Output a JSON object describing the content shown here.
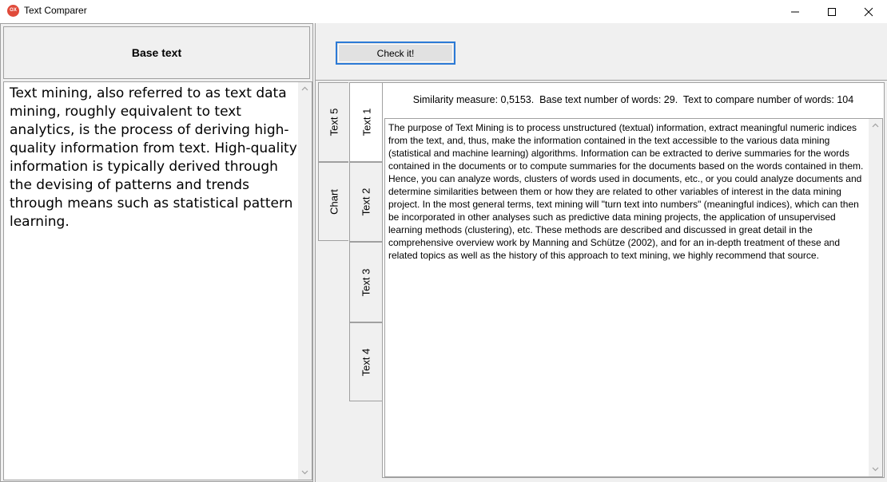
{
  "window": {
    "title": "Text Comparer",
    "app_icon": "OX",
    "controls": [
      "minimize-icon",
      "maximize-icon",
      "close-icon"
    ]
  },
  "left": {
    "header": "Base text",
    "base_text": "Text mining, also referred to as text data mining, roughly equivalent to text analytics, is the process of deriving high-quality information from text. High-quality information is typically derived through the devising of patterns and trends through means such as statistical pattern learning."
  },
  "toolbar": {
    "check_label": "Check it!"
  },
  "tabs": {
    "outer": [
      "Text 5",
      "Chart"
    ],
    "inner": [
      "Text 1",
      "Text 2",
      "Text 3",
      "Text 4"
    ],
    "selected": "Text 1"
  },
  "result": {
    "similarity_line": "Similarity measure: 0,5153.  Base text number of words: 29.  Text to compare number of words: 104",
    "compare_text": "The purpose of Text Mining is to process unstructured (textual) information, extract meaningful numeric indices from the text, and, thus, make the information contained in the text accessible to the various data mining (statistical and machine learning) algorithms. Information can be extracted to derive summaries for the words contained in the documents or to compute summaries for the documents based on the words contained in them. Hence, you can analyze words, clusters of words used in documents, etc., or you could analyze documents and determine similarities between them or how they are related to other variables of interest in the data mining project. In the most general terms, text mining will \"turn text into numbers\" (meaningful indices), which can then be incorporated in other analyses such as predictive data mining projects, the application of unsupervised learning methods (clustering), etc. These methods are described and discussed in great detail in the comprehensive overview work by Manning and Schütze (2002), and for an in-depth treatment of these and related topics as well as the history of this approach to text mining, we highly recommend that source."
  },
  "colors": {
    "accent": "#2c7ad6",
    "app_icon": "#e04a3a"
  }
}
